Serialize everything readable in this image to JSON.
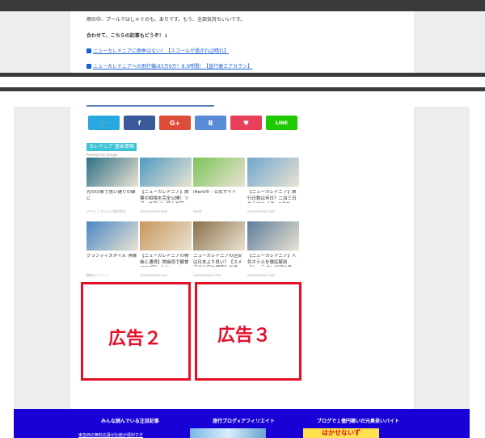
{
  "article": {
    "line1": "雨の中、プールではしゃぐのも、ありです。もう、全部気持ちいいです。",
    "line2": "合わせて、こちらの記事もどうぞ！↓",
    "link1": "ニューカレドニアに雨季はない！【スコールが過ぎれば晴れ】",
    "link2": "ニューカレドニアへの飛行機は5万6万！8.5時間！【直行便エアカラン】"
  },
  "share": {
    "twitter": "🐦",
    "facebook": "f",
    "google": "G+",
    "hatena": "B",
    "pocket": "♥",
    "line": "LINE",
    "colors": {
      "twitter": "#2aa8e0",
      "facebook": "#3b5a9a",
      "google": "#dd4b39",
      "hatena": "#5a8bd6",
      "pocket": "#e8405a",
      "line": "#1fc900"
    }
  },
  "related": {
    "tag": "カレドニア 基本情報",
    "powered": "Powered by Google",
    "cards": [
      {
        "caption": "光の印象で思い通りの縁に",
        "source": "アドビ システムズ株式会社",
        "color": "#2f6f86"
      },
      {
        "caption": "【ニューカレドニア】旅費の相場を完全公開！ツアーは高い！個人が安...",
        "source": "sakamotomi.com",
        "color": "#4d9ac0"
      },
      {
        "caption": "iHerb® - 公式サイト",
        "source": "iHerb",
        "color": "#7cc458"
      },
      {
        "caption": "【ニューカレドニア】旅行日数は何日？二泊三日からOK！4泊・5泊な...",
        "source": "sakamotomi.com",
        "color": "#6fa6cf"
      },
      {
        "caption": "グランディスタイル 沖縄",
        "source": "静寂のリゾート",
        "color": "#4c88c4"
      },
      {
        "caption": "【ニューカレドニアの物価と通貨】物価両で観食4000円！ドルレート...",
        "source": "sakamotomi.com",
        "color": "#c9955a"
      },
      {
        "caption": "ニューカレドニアの治安は日本より良い？【スメアの治安を調査】六単...",
        "source": "sakamotomi.com",
        "color": "#8a6f4a"
      },
      {
        "caption": "【ニューカレドニア】人気ホテルを徹底解剖【ル・ラゴンが超お手...",
        "source": "sakamotomi.com",
        "color": "#5d7d9c"
      }
    ]
  },
  "ads": {
    "ad2": "広告２",
    "ad3": "広告３"
  },
  "footer": {
    "col1": "みんな読んでいる注目記事",
    "col1_item": "東急西の無料応募が比較が便利すぎ",
    "col2": "旅行ブログ×アフィリエイト",
    "col3": "ブログで１億円稼いだ元奥茶いバイト",
    "col3_banner": "はかせないず"
  }
}
